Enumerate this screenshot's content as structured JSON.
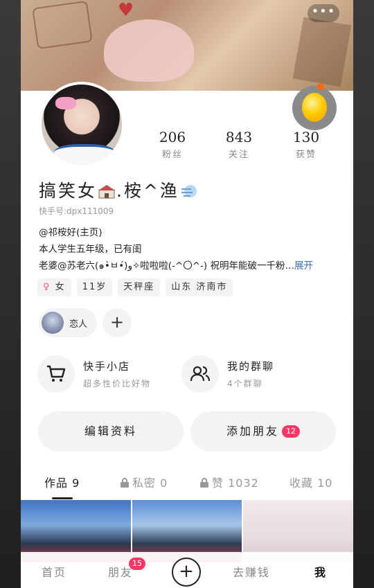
{
  "header": {
    "more_label": "•••"
  },
  "profile": {
    "name": "搞笑女",
    "name_mid": ".桉^渔",
    "kuaishou_id": "快手号:dpx111009",
    "stats": [
      {
        "value": "206",
        "label": "粉丝"
      },
      {
        "value": "843",
        "label": "关注"
      },
      {
        "value": "130",
        "label": "获赞"
      }
    ],
    "bio_lines": [
      "@祁桉好(主页)",
      "本人学生五年级，已有闺",
      "老婆@苏老六(๑•̀ㅂ•́)و✧啦啦啦(-^〇^-) 祝明年能破一千粉…"
    ],
    "bio_expand": "展开",
    "tags": [
      {
        "icon": "♀",
        "label": "女"
      },
      {
        "label": "11岁"
      },
      {
        "label": "天秤座"
      },
      {
        "label": "山东 济南市"
      }
    ],
    "relation_label": "恋人",
    "relation_add": "+"
  },
  "features": {
    "shop_title": "快手小店",
    "shop_sub": "超多性价比好物",
    "group_title": "我的群聊",
    "group_sub": "4个群聊"
  },
  "actions": {
    "edit_profile": "编辑资料",
    "add_friend": "添加朋友",
    "add_friend_badge": "12"
  },
  "tabs": {
    "works": "作品 9",
    "private": "私密 0",
    "likes": "赞 1032",
    "favorites": "收藏 10"
  },
  "bottom_nav": {
    "home": "首页",
    "friends": "朋友",
    "friends_badge": "15",
    "create": "+",
    "earn": "去赚钱",
    "me": "我"
  },
  "colors": {
    "accent": "#fe3666",
    "link": "#3d6ea8"
  }
}
